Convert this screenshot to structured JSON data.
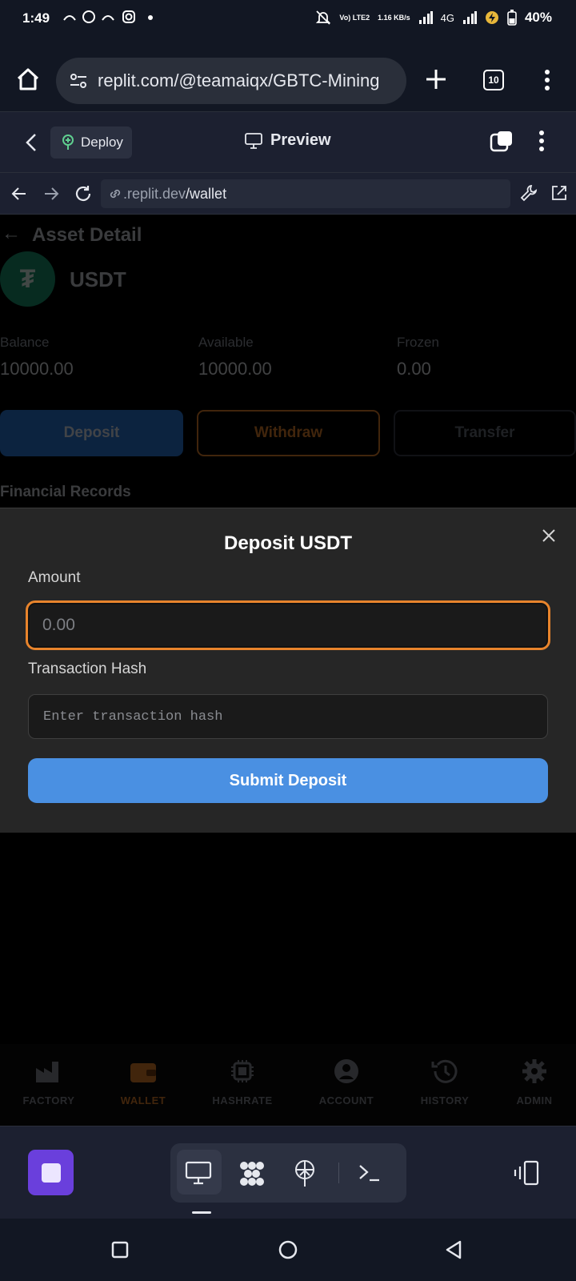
{
  "status_bar": {
    "time": "1:49",
    "battery": "40%",
    "network": "4G",
    "volte": "Vo) LTE2",
    "speed": "1.16 KB/s",
    "left_icons": [
      "missed-call-icon",
      "whatsapp-icon",
      "missed-call-icon",
      "instagram-icon",
      "dot-icon"
    ]
  },
  "browser": {
    "url": "replit.com/@teamaiqx/GBTC-Mining",
    "tab_count": "10"
  },
  "replit_header": {
    "deploy_label": "Deploy",
    "preview_label": "Preview"
  },
  "mini_browser": {
    "domain": ".replit.dev",
    "path": "/wallet"
  },
  "asset": {
    "title": "Asset Detail",
    "coin_symbol": "₮",
    "coin_name": "USDT",
    "balance_label": "Balance",
    "balance_value": "10000.00",
    "available_label": "Available",
    "available_value": "10000.00",
    "frozen_label": "Frozen",
    "frozen_value": "0.00",
    "deposit_label": "Deposit",
    "withdraw_label": "Withdraw",
    "transfer_label": "Transfer",
    "records_label": "Financial Records"
  },
  "modal": {
    "title": "Deposit USDT",
    "amount_label": "Amount",
    "amount_placeholder": "0.00",
    "hash_label": "Transaction Hash",
    "hash_placeholder": "Enter transaction hash",
    "submit_label": "Submit Deposit"
  },
  "app_nav": [
    {
      "label": "FACTORY",
      "icon": "factory-icon"
    },
    {
      "label": "WALLET",
      "icon": "wallet-icon",
      "active": true
    },
    {
      "label": "HASHRATE",
      "icon": "chip-icon"
    },
    {
      "label": "ACCOUNT",
      "icon": "user-circle-icon"
    },
    {
      "label": "HISTORY",
      "icon": "history-icon"
    },
    {
      "label": "ADMIN",
      "icon": "gear-icon"
    }
  ],
  "colors": {
    "accent_orange": "#e8842c",
    "submit_blue": "#4a90e2",
    "coin_green": "#1a9b73",
    "stop_purple": "#6a3fdc"
  }
}
